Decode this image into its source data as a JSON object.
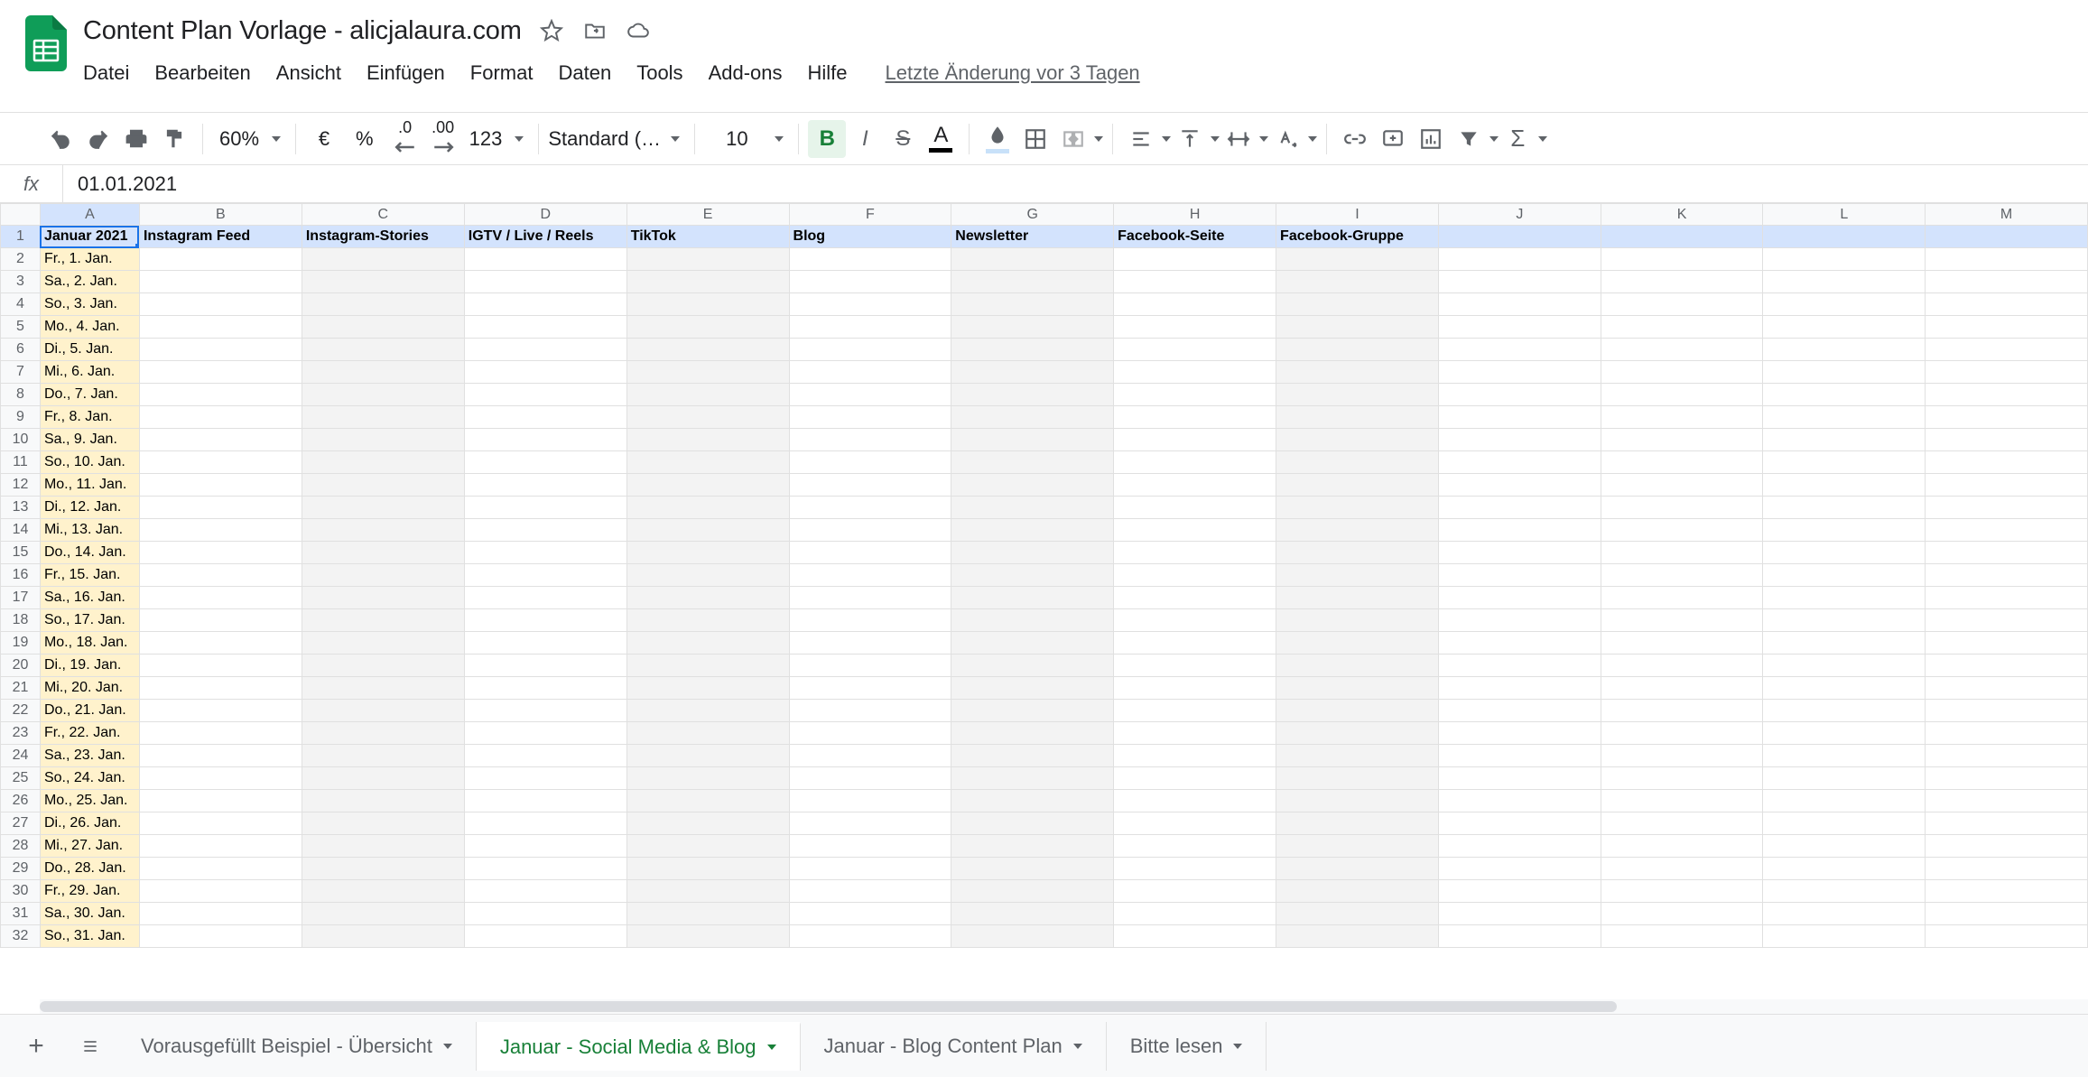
{
  "doc": {
    "title": "Content Plan Vorlage - alicjalaura.com",
    "last_edit": "Letzte Änderung vor 3 Tagen"
  },
  "menu": {
    "file": "Datei",
    "edit": "Bearbeiten",
    "view": "Ansicht",
    "insert": "Einfügen",
    "format": "Format",
    "data": "Daten",
    "tools": "Tools",
    "addons": "Add-ons",
    "help": "Hilfe"
  },
  "toolbar": {
    "zoom": "60%",
    "currency": "€",
    "percent": "%",
    "dec_minus": ".0",
    "dec_plus": ".00",
    "more_formats": "123",
    "font_name": "Standard (…",
    "font_size": "10",
    "bold": "B",
    "italic": "I",
    "strike": "S",
    "text_color_letter": "A"
  },
  "formula": {
    "fx": "fx",
    "value": "01.01.2021"
  },
  "columns": [
    "A",
    "B",
    "C",
    "D",
    "E",
    "F",
    "G",
    "H",
    "I",
    "J",
    "K",
    "L",
    "M"
  ],
  "header_row": {
    "A": "Januar 2021",
    "B": "Instagram Feed",
    "C": "Instagram-Stories",
    "D": "IGTV / Live / Reels",
    "E": "TikTok",
    "F": "Blog",
    "G": "Newsletter",
    "H": "Facebook-Seite",
    "I": "Facebook-Gruppe"
  },
  "dates": [
    "Fr., 1. Jan.",
    "Sa., 2. Jan.",
    "So., 3. Jan.",
    "Mo., 4. Jan.",
    "Di., 5. Jan.",
    "Mi., 6. Jan.",
    "Do., 7. Jan.",
    "Fr., 8. Jan.",
    "Sa., 9. Jan.",
    "So., 10. Jan.",
    "Mo., 11. Jan.",
    "Di., 12. Jan.",
    "Mi., 13. Jan.",
    "Do., 14. Jan.",
    "Fr., 15. Jan.",
    "Sa., 16. Jan.",
    "So., 17. Jan.",
    "Mo., 18. Jan.",
    "Di., 19. Jan.",
    "Mi., 20. Jan.",
    "Do., 21. Jan.",
    "Fr., 22. Jan.",
    "Sa., 23. Jan.",
    "So., 24. Jan.",
    "Mo., 25. Jan.",
    "Di., 26. Jan.",
    "Mi., 27. Jan.",
    "Do., 28. Jan.",
    "Fr., 29. Jan.",
    "Sa., 30. Jan.",
    "So., 31. Jan."
  ],
  "tabs": {
    "t1": "Vorausgefüllt Beispiel - Übersicht",
    "t2": "Januar - Social Media & Blog",
    "t3": "Januar - Blog Content Plan",
    "t4": "Bitte lesen"
  }
}
